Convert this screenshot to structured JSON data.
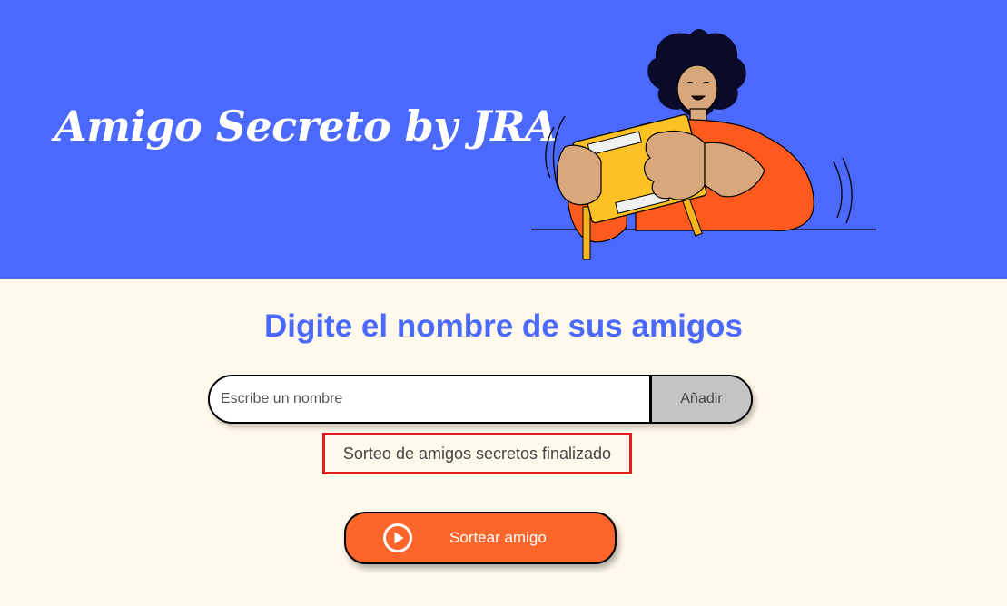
{
  "header": {
    "title": "Amigo Secreto by JRA",
    "illustration_icon": "person-holding-gift-illustration",
    "background_color": "#4B69FD"
  },
  "main": {
    "section_title": "Digite el nombre de sus amigos",
    "name_input": {
      "placeholder": "Escribe un nombre",
      "value": ""
    },
    "add_button_label": "Añadir",
    "result_text": "Sorteo de amigos secretos finalizado",
    "draw_button_label": "Sortear amigo",
    "draw_button_icon": "play-icon"
  },
  "colors": {
    "accent": "#4B69FD",
    "button_orange": "#FE652B",
    "page_background": "#FFF9EB",
    "highlight_border": "#E01E1E"
  }
}
